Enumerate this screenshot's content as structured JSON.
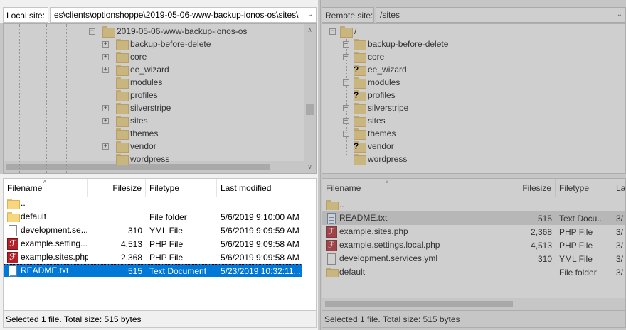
{
  "local": {
    "site_label": "Local site:",
    "site_path": "es\\clients\\optionshoppe\\2019-05-06-www-backup-ionos-os\\sites\\",
    "tree": [
      {
        "label": "2019-05-06-www-backup-ionos-os",
        "expander": "−"
      },
      {
        "label": "backup-before-delete",
        "expander": "+"
      },
      {
        "label": "core",
        "expander": "+"
      },
      {
        "label": "ee_wizard",
        "expander": "+"
      },
      {
        "label": "modules",
        "expander": ""
      },
      {
        "label": "profiles",
        "expander": ""
      },
      {
        "label": "silverstripe",
        "expander": "+"
      },
      {
        "label": "sites",
        "expander": "+"
      },
      {
        "label": "themes",
        "expander": ""
      },
      {
        "label": "vendor",
        "expander": "+"
      },
      {
        "label": "wordpress",
        "expander": ""
      }
    ],
    "columns": {
      "filename": "Filename",
      "filesize": "Filesize",
      "filetype": "Filetype",
      "modified": "Last modified"
    },
    "files": [
      {
        "name": "..",
        "size": "",
        "type": "",
        "modified": "",
        "icon": "folder-icon"
      },
      {
        "name": "default",
        "size": "",
        "type": "File folder",
        "modified": "5/6/2019 9:10:00 AM",
        "icon": "folder-icon"
      },
      {
        "name": "development.se...",
        "size": "310",
        "type": "YML File",
        "modified": "5/6/2019 9:09:59 AM",
        "icon": "document-icon"
      },
      {
        "name": "example.setting...",
        "size": "4,513",
        "type": "PHP File",
        "modified": "5/6/2019 9:09:58 AM",
        "icon": "php-file-icon"
      },
      {
        "name": "example.sites.php",
        "size": "2,368",
        "type": "PHP File",
        "modified": "5/6/2019 9:09:58 AM",
        "icon": "php-file-icon"
      },
      {
        "name": "README.txt",
        "size": "515",
        "type": "Text Document",
        "modified": "5/23/2019 10:32:11...",
        "icon": "text-file-icon",
        "selected": true
      }
    ],
    "status": "Selected 1 file. Total size: 515 bytes"
  },
  "remote": {
    "site_label": "Remote site:",
    "site_path": "/sites",
    "tree": [
      {
        "label": "/",
        "expander": "−",
        "unknown": false
      },
      {
        "label": "backup-before-delete",
        "expander": "+",
        "unknown": false
      },
      {
        "label": "core",
        "expander": "+",
        "unknown": false
      },
      {
        "label": "ee_wizard",
        "expander": "",
        "unknown": true
      },
      {
        "label": "modules",
        "expander": "+",
        "unknown": false
      },
      {
        "label": "profiles",
        "expander": "",
        "unknown": true
      },
      {
        "label": "silverstripe",
        "expander": "+",
        "unknown": false
      },
      {
        "label": "sites",
        "expander": "+",
        "unknown": false
      },
      {
        "label": "themes",
        "expander": "+",
        "unknown": false
      },
      {
        "label": "vendor",
        "expander": "",
        "unknown": true
      },
      {
        "label": "wordpress",
        "expander": "",
        "unknown": false
      }
    ],
    "columns": {
      "filename": "Filename",
      "filesize": "Filesize",
      "filetype": "Filetype",
      "modified": "La"
    },
    "files": [
      {
        "name": "..",
        "size": "",
        "type": "",
        "modified": "",
        "icon": "folder-icon"
      },
      {
        "name": "README.txt",
        "size": "515",
        "type": "Text Docu...",
        "modified": "3/",
        "icon": "text-file-icon",
        "highlight": true
      },
      {
        "name": "example.sites.php",
        "size": "2,368",
        "type": "PHP File",
        "modified": "3/",
        "icon": "php-file-icon"
      },
      {
        "name": "example.settings.local.php",
        "size": "4,513",
        "type": "PHP File",
        "modified": "3/",
        "icon": "php-file-icon"
      },
      {
        "name": "development.services.yml",
        "size": "310",
        "type": "YML File",
        "modified": "3/",
        "icon": "document-icon"
      },
      {
        "name": "default",
        "size": "",
        "type": "File folder",
        "modified": "3/",
        "icon": "folder-icon"
      }
    ],
    "status": "Selected 1 file. Total size: 515 bytes"
  },
  "colors": {
    "selection": "#0078d7",
    "folder": "#f6d77d",
    "php": "#b32028"
  }
}
